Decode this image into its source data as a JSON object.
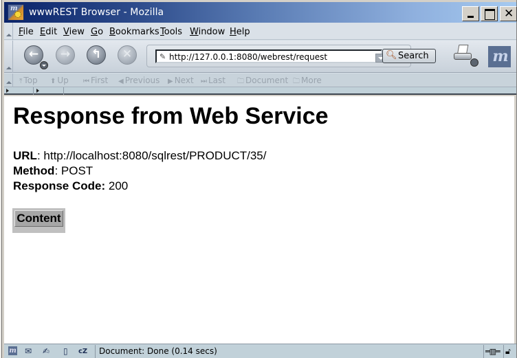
{
  "window": {
    "title": "wwwREST Browser - Mozilla",
    "app_icon": "mozilla-app-icon",
    "controls": {
      "minimize": "minimize",
      "maximize": "maximize",
      "close": "✕"
    }
  },
  "menubar": {
    "items": [
      {
        "label": "File",
        "accel": "F"
      },
      {
        "label": "Edit",
        "accel": "E"
      },
      {
        "label": "View",
        "accel": "V"
      },
      {
        "label": "Go",
        "accel": "G"
      },
      {
        "label": "Bookmarks",
        "accel": "B"
      },
      {
        "label": "Tools",
        "accel": "T"
      },
      {
        "label": "Window",
        "accel": "W"
      },
      {
        "label": "Help",
        "accel": "H"
      }
    ]
  },
  "navbar": {
    "back": "back-icon",
    "forward": "forward-icon",
    "reload": "reload-icon",
    "stop": "stop-icon",
    "url": "http://127.0.0.1:8080/webrest/request",
    "search_label": "Search",
    "print": "print-icon",
    "logo": "mozilla-logo"
  },
  "site_nav": {
    "items": [
      {
        "label": "Top",
        "icon": "⤒"
      },
      {
        "label": "Up",
        "icon": "⬆"
      },
      {
        "label": "First",
        "icon": "⏮"
      },
      {
        "label": "Previous",
        "icon": "◀"
      },
      {
        "label": "Next",
        "icon": "▶"
      },
      {
        "label": "Last",
        "icon": "⏭"
      },
      {
        "label": "Document",
        "icon": "🗀"
      },
      {
        "label": "More",
        "icon": "🗀"
      }
    ]
  },
  "page": {
    "title": "Response from Web Service",
    "url_label": "URL",
    "url_value": ": http://localhost:8080/sqlrest/PRODUCT/35/",
    "method_label": "Method",
    "method_value": ": POST",
    "code_label": "Response Code:",
    "code_value": " 200",
    "content_heading": "Content"
  },
  "statusbar": {
    "text": "Document: Done (0.14 secs)",
    "icons": [
      "mozilla",
      "mail",
      "composer",
      "address-book",
      "irc-chat"
    ]
  }
}
